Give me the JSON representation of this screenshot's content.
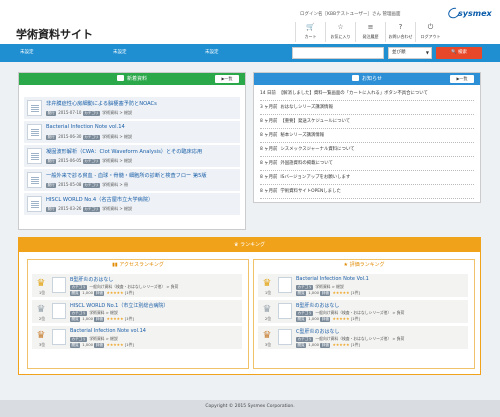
{
  "header": {
    "title": "学術資料サイト",
    "user_line": "ログイン名［KBBテストユーザー］さん 管理画面",
    "logo_text": "sysmex",
    "icons": [
      {
        "icon": "cart-icon",
        "label": "カート"
      },
      {
        "icon": "favorite-icon",
        "label": "お気に入り"
      },
      {
        "icon": "history-icon",
        "label": "発注履歴"
      },
      {
        "icon": "contact-icon",
        "label": "お問い合わせ"
      },
      {
        "icon": "logout-icon",
        "label": "ログアウト"
      }
    ]
  },
  "nav": {
    "items": [
      "未設定",
      "未設定",
      "未設定"
    ],
    "search_placeholder": "",
    "select_value": "並び順",
    "search_label": "検索"
  },
  "new_materials": {
    "title": "新着資料",
    "more": "一覧",
    "items": [
      {
        "title": "非弁膜症性心房細動による脳梗塞予防とNOACs",
        "date": "2015-07-10",
        "tag": "カテゴリ",
        "category": "学術資料 > 総説"
      },
      {
        "title": "Bacterial Infection Note vol.14",
        "date": "2015-06-30",
        "tag": "カテゴリ",
        "category": "学術資料 > 総説"
      },
      {
        "title": "凝固波形解析（CWA：Clot Waveform Analysis）とその臨床応用",
        "date": "2015-06-05",
        "tag": "カテゴリ",
        "category": "学術資料 > 総説"
      },
      {
        "title": "一般外来で診る貧血 - 血球・骨髄・細胞所の診断と検査フロー 第5版",
        "date": "2015-05-08",
        "tag": "カテゴリ",
        "category": "学術資料 > 冊"
      },
      {
        "title": "HISCL WORLD No.4（名古屋市立大学病院）",
        "date": "2015-03-26",
        "tag": "カテゴリ",
        "category": "学術資料 > 総説"
      }
    ]
  },
  "notices": {
    "title": "お知らせ",
    "more": "一覧",
    "items": [
      {
        "ago": "14 日前",
        "text": "【解消しました】資料一覧画面の「カートに入れる」ボタン不具合について"
      },
      {
        "ago": "3 ヶ月前",
        "text": "おはなしシリーズ講演情報"
      },
      {
        "ago": "8 ヶ月前",
        "text": "【重要】発送スケジュールについて"
      },
      {
        "ago": "8 ヶ月前",
        "text": "秘本シリーズ講演情報"
      },
      {
        "ago": "8 ヶ月前",
        "text": "シスメックスジャーナル資料について"
      },
      {
        "ago": "8 ヶ月前",
        "text": "外国語資料の掲載について"
      },
      {
        "ago": "8 ヶ月前",
        "text": "ISバージョンアップをお願いします"
      },
      {
        "ago": "8 ヶ月前",
        "text": "学術資料サイトOPENしました"
      }
    ]
  },
  "ranking": {
    "title": "ランキング",
    "access": {
      "title": "アクセスランキング",
      "items": [
        {
          "rank": "1位",
          "title": "B型肝炎のおはなし",
          "tag": "カテゴリ",
          "category": "一般向け資料（検査・おはなしシリーズ他） > 負荷",
          "views": "1,000",
          "stars": "★★★★★",
          "count": "[1件]"
        },
        {
          "rank": "2位",
          "title": "HISCL WORLD No.1（市立江別総合病院）",
          "tag": "カテゴリ",
          "category": "学術資料 > 総説",
          "views": "1,000",
          "stars": "★★★★★",
          "count": "[1件]"
        },
        {
          "rank": "3位",
          "title": "Bacterial Infection Note vol.14",
          "tag": "カテゴリ",
          "category": "学術資料 > 総説",
          "views": "1,000",
          "stars": "★★★★★",
          "count": "[1件]"
        }
      ]
    },
    "rating": {
      "title": "評価ランキング",
      "items": [
        {
          "rank": "1位",
          "title": "Bacterial Infection Note Vol.1",
          "tag": "カテゴリ",
          "category": "学術資料 > 総説",
          "views": "1,000",
          "stars": "★★★★★",
          "count": "[1件]"
        },
        {
          "rank": "2位",
          "title": "B型肝炎のおはなし",
          "tag": "カテゴリ",
          "category": "一般向け資料（検査・おはなしシリーズ他） > 負荷",
          "views": "1,000",
          "stars": "★★★★★",
          "count": "[1件]"
        },
        {
          "rank": "3位",
          "title": "C型肝炎のおはなし",
          "tag": "カテゴリ",
          "category": "一般向け資料（検査・おはなしシリーズ他） > 負荷",
          "views": "1,000",
          "stars": "★★★★★",
          "count": "[1件]"
        }
      ]
    }
  },
  "footer": {
    "copyright": "Copyright © 2015 Sysmex Corporation."
  },
  "colors": {
    "nav": "#1f8fd2",
    "new": "#2aa84a",
    "notice": "#2d8fd6",
    "ranking": "#f0a21b",
    "search_btn": "#e8482a"
  }
}
